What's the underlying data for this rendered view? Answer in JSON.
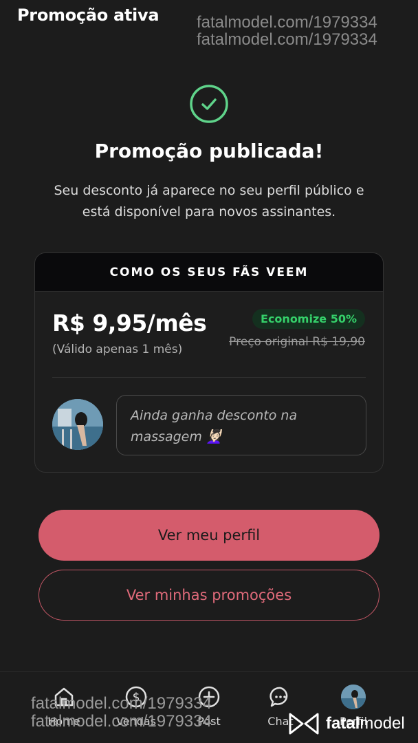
{
  "header": {
    "title": "Promoção ativa"
  },
  "watermark_top": [
    "fatalmodel.com/1979334",
    "fatalmodel.com/1979334"
  ],
  "success": {
    "icon": "check-circle-icon",
    "title": "Promoção publicada!",
    "description": "Seu desconto já aparece no seu perfil público e está disponível para novos assinantes."
  },
  "preview": {
    "heading": "COMO OS SEUS FÃS VEEM",
    "price": "R$ 9,95/mês",
    "validity": "(Válido apenas 1 mês)",
    "save_badge": "Economize 50%",
    "original_price": "Preço original R$ 19,90",
    "note": "Ainda ganha desconto na massagem 💆🏻‍♀️"
  },
  "buttons": {
    "primary": "Ver meu perfil",
    "secondary": "Ver minhas promoções"
  },
  "nav": [
    {
      "label": "Home",
      "icon": "home-icon"
    },
    {
      "label": "Vendas",
      "icon": "dollar-icon"
    },
    {
      "label": "Post",
      "icon": "plus-circle-icon"
    },
    {
      "label": "Chat",
      "icon": "chat-icon"
    },
    {
      "label": "Perfil",
      "icon": "avatar"
    }
  ],
  "watermark_bottom": [
    "fatalmodel.com/1979334",
    "fatalmodel.com/1979334"
  ],
  "brand": {
    "bold": "fatal",
    "regular": "model"
  },
  "colors": {
    "background": "#1c1c1c",
    "success_green": "#5fd38a",
    "accent_pink": "#d45c6c",
    "badge_green": "#35d06a"
  }
}
